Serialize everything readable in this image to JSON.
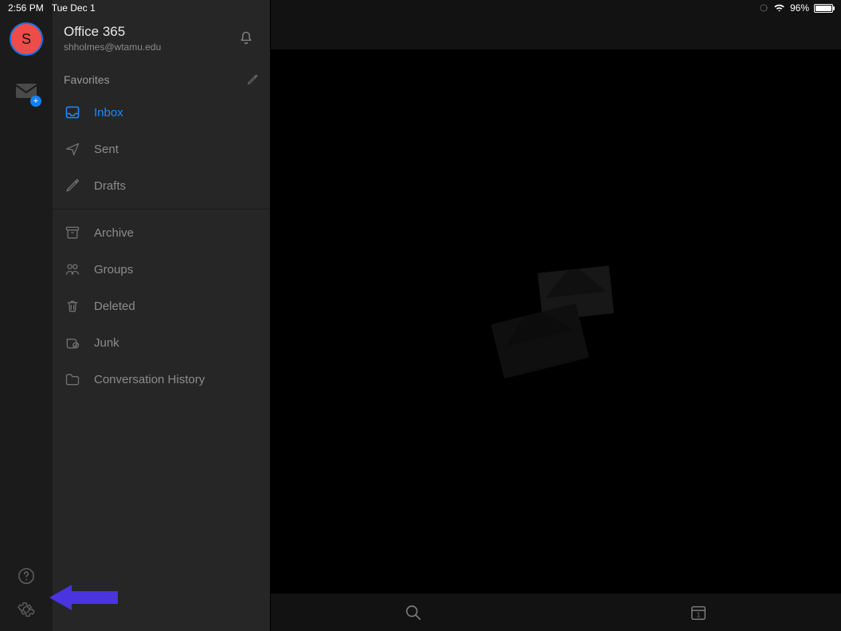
{
  "statusbar": {
    "time": "2:56 PM",
    "date": "Tue Dec 1",
    "battery_text": "96%"
  },
  "account": {
    "avatar_initial": "S",
    "service_name": "Office 365",
    "email": "shholmes@wtamu.edu"
  },
  "sidebar": {
    "favorites_label": "Favorites",
    "folders_fav": [
      {
        "label": "Inbox",
        "icon": "inbox",
        "active": true
      },
      {
        "label": "Sent",
        "icon": "sent"
      },
      {
        "label": "Drafts",
        "icon": "drafts"
      }
    ],
    "folders_more": [
      {
        "label": "Archive",
        "icon": "archive"
      },
      {
        "label": "Groups",
        "icon": "groups"
      },
      {
        "label": "Deleted",
        "icon": "trash"
      },
      {
        "label": "Junk",
        "icon": "junk"
      },
      {
        "label": "Conversation History",
        "icon": "folder"
      }
    ]
  },
  "bottombar": {
    "calendar_day": "1"
  }
}
